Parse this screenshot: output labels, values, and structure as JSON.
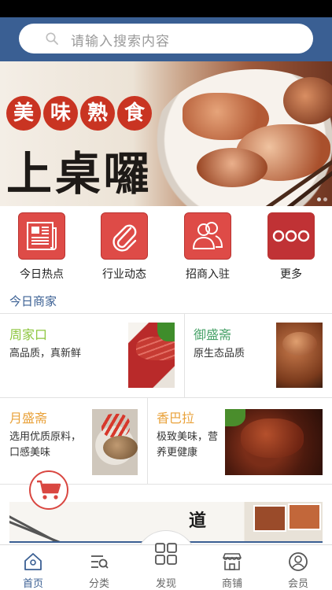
{
  "search": {
    "placeholder": "请输入搜索内容"
  },
  "banner": {
    "subtitle_chars": [
      "美",
      "味",
      "熟",
      "食"
    ],
    "headline": "上桌囉"
  },
  "quick_links": [
    {
      "label": "今日热点",
      "icon": "newspaper-icon"
    },
    {
      "label": "行业动态",
      "icon": "paperclip-icon"
    },
    {
      "label": "招商入驻",
      "icon": "users-icon"
    },
    {
      "label": "更多",
      "icon": "more-dots-icon"
    }
  ],
  "section": {
    "title": "今日商家"
  },
  "merchants": [
    {
      "name": "周家口",
      "desc": "高品质，真新鲜",
      "name_color": "#8dc63f"
    },
    {
      "name": "御盛斋",
      "desc": "原生态品质",
      "name_color": "#4aa36a"
    },
    {
      "name": "月盛斋",
      "desc": "选用优质原料，口感美味",
      "name_color": "#e9a23b"
    },
    {
      "name": "香巴拉",
      "desc": "极致美味，营养更健康",
      "name_color": "#e9a23b"
    }
  ],
  "promo_strip": {
    "text": "道"
  },
  "tabbar": [
    {
      "label": "首页",
      "icon": "home-icon",
      "active": true
    },
    {
      "label": "分类",
      "icon": "category-list-icon",
      "active": false
    },
    {
      "label": "发现",
      "icon": "grid-icon",
      "active": false
    },
    {
      "label": "商铺",
      "icon": "storefront-icon",
      "active": false
    },
    {
      "label": "会员",
      "icon": "user-icon",
      "active": false
    }
  ],
  "colors": {
    "header": "#3a5f93",
    "accent_red": "#de4b47",
    "tab_active": "#3a5f93"
  }
}
